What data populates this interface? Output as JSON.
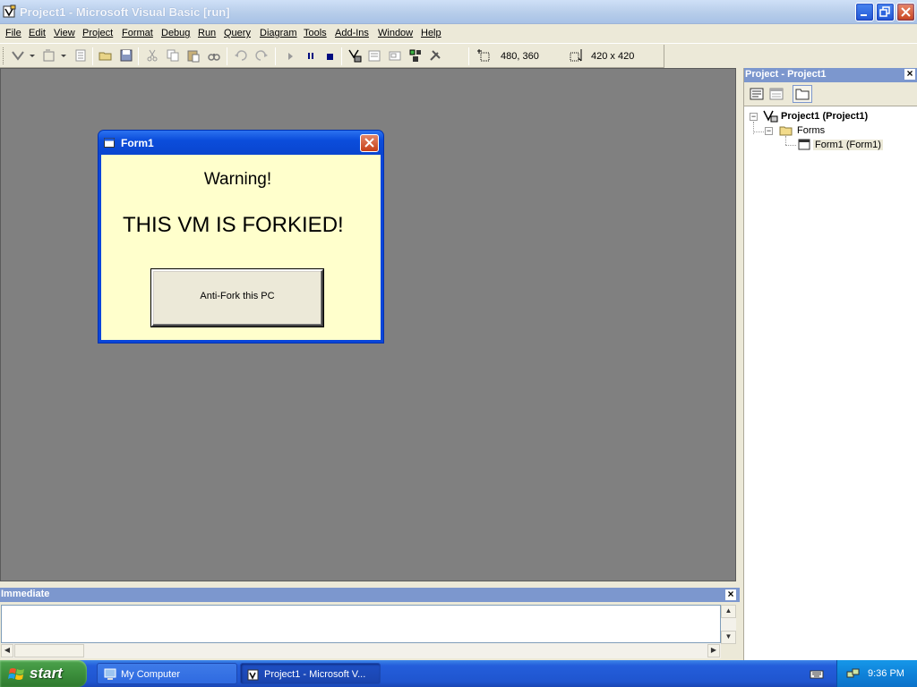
{
  "window": {
    "title": "Project1 - Microsoft Visual Basic [run]"
  },
  "menu": [
    "File",
    "Edit",
    "View",
    "Project",
    "Format",
    "Debug",
    "Run",
    "Query",
    "Diagram",
    "Tools",
    "Add-Ins",
    "Window",
    "Help"
  ],
  "toolbar": {
    "position": "480, 360",
    "size": "420 x 420"
  },
  "project_panel": {
    "title": "Project - Project1",
    "tree": {
      "root": "Project1 (Project1)",
      "folder": "Forms",
      "item": "Form1 (Form1)"
    }
  },
  "immediate": {
    "title": "Immediate",
    "text": ""
  },
  "form": {
    "title": "Form1",
    "warning": "Warning!",
    "message": "THIS VM IS FORKIED!",
    "button": "Anti-Fork this PC",
    "background": "#FFFFCC"
  },
  "taskbar": {
    "start": "start",
    "tasks": [
      "My Computer",
      "Project1 - Microsoft V..."
    ],
    "clock": "9:36 PM"
  },
  "colors": {
    "mdi_background": "#808080",
    "panel_caption": "#7C97CE",
    "xp_blue": "#0A46DA"
  }
}
